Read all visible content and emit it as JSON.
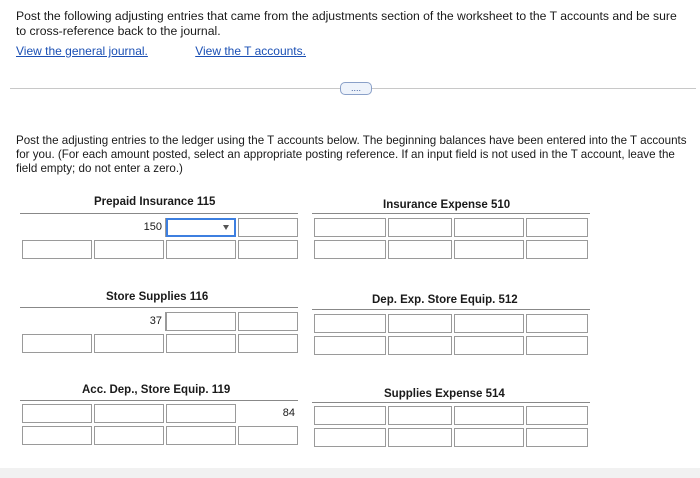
{
  "intro": "Post the following adjusting entries that came from the adjustments section of the worksheet to the T accounts and be sure to cross-reference back to the journal.",
  "links": {
    "general_journal": "View the general journal.",
    "t_accounts": "View the T accounts."
  },
  "more_button": "....",
  "instructions": "Post the adjusting entries to the ledger using the T accounts below. The beginning balances have been entered into the T accounts for you. (For each amount posted, select an appropriate posting reference. If an input field is not used in the T account, leave the field empty; do not enter a zero.)",
  "accounts": [
    {
      "title": "Prepaid Insurance 115",
      "balance": "150"
    },
    {
      "title": "Insurance Expense 510"
    },
    {
      "title": "Store Supplies 116",
      "balance": "37"
    },
    {
      "title": "Dep. Exp. Store Equip. 512"
    },
    {
      "title": "Acc. Dep., Store Equip. 119",
      "balance": "84"
    },
    {
      "title": "Supplies Expense 514"
    }
  ]
}
